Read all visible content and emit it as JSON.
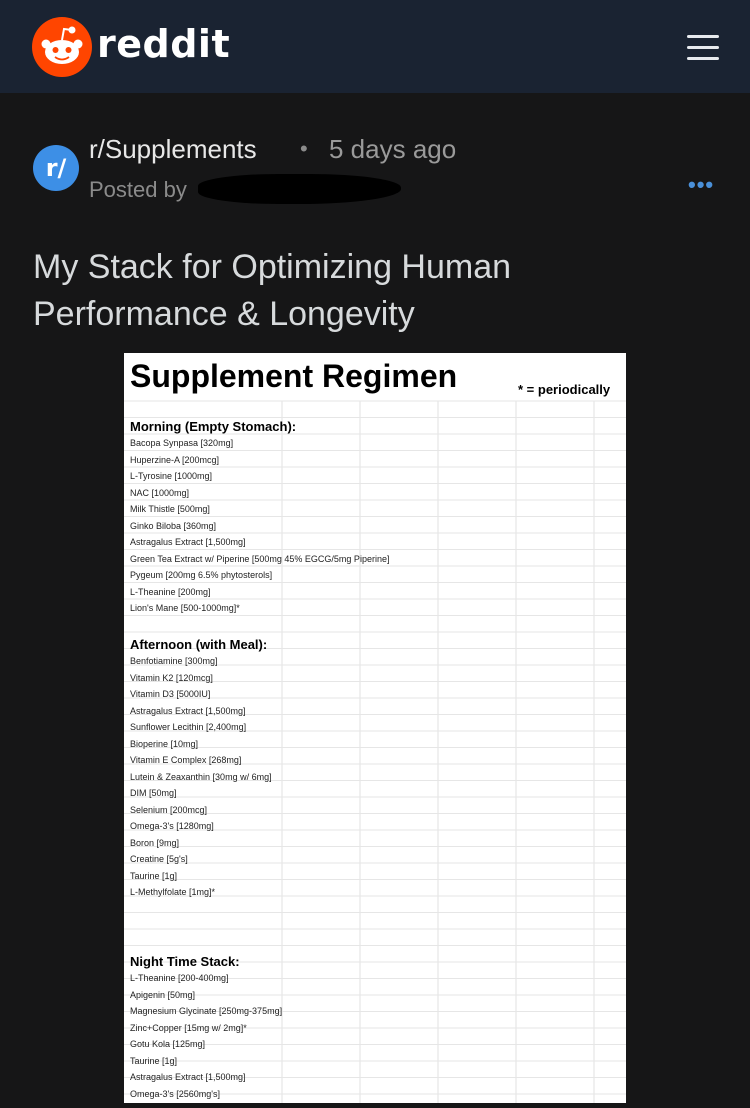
{
  "header": {
    "logo_text": "reddit",
    "menu_icon": "hamburger-menu-icon",
    "brand_color": "#ff4500",
    "bar_color": "#1a2332"
  },
  "post": {
    "subreddit_icon_text": "r/",
    "subreddit": "r/Supplements",
    "separator": "•",
    "time_ago": "5 days ago",
    "posted_by": "Posted by",
    "more_icon": "more-options-icon",
    "title": "My Stack for Optimizing Human Performance & Longevity"
  },
  "sheet": {
    "title": "Supplement Regimen",
    "note": "* = periodically",
    "sections": [
      {
        "header": "Morning (Empty Stomach):",
        "items": [
          "Bacopa Synpasa [320mg]",
          "Huperzine-A [200mcg]",
          "L-Tyrosine [1000mg]",
          "NAC [1000mg]",
          "Milk Thistle [500mg]",
          "Ginko Biloba [360mg]",
          "Astragalus Extract [1,500mg]",
          "Green Tea Extract w/ Piperine [500mg 45% EGCG/5mg Piperine]",
          "Pygeum [200mg 6.5% phytosterols]",
          "L-Theanine [200mg]",
          "Lion's Mane [500-1000mg]*"
        ]
      },
      {
        "header": "Afternoon (with Meal):",
        "items": [
          "Benfotiamine [300mg]",
          "Vitamin K2 [120mcg]",
          "Vitamin D3 [5000IU]",
          "Astragalus Extract [1,500mg]",
          "Sunflower Lecithin [2,400mg]",
          "Bioperine [10mg]",
          "Vitamin E Complex [268mg]",
          "Lutein & Zeaxanthin [30mg w/ 6mg]",
          "DIM [50mg]",
          "Selenium [200mcg]",
          "Omega-3's [1280mg]",
          "Boron [9mg]",
          "Creatine [5g's]",
          "Taurine [1g]",
          "L-Methylfolate [1mg]*"
        ]
      },
      {
        "header": "Night Time Stack:",
        "items": [
          "L-Theanine [200-400mg]",
          "Apigenin [50mg]",
          "Magnesium Glycinate [250mg-375mg]",
          "Zinc+Copper [15mg w/ 2mg]*",
          "Gotu Kola [125mg]",
          "Taurine [1g]",
          "Astragalus Extract [1,500mg]",
          "Omega-3's [2560mg's]"
        ]
      }
    ]
  }
}
